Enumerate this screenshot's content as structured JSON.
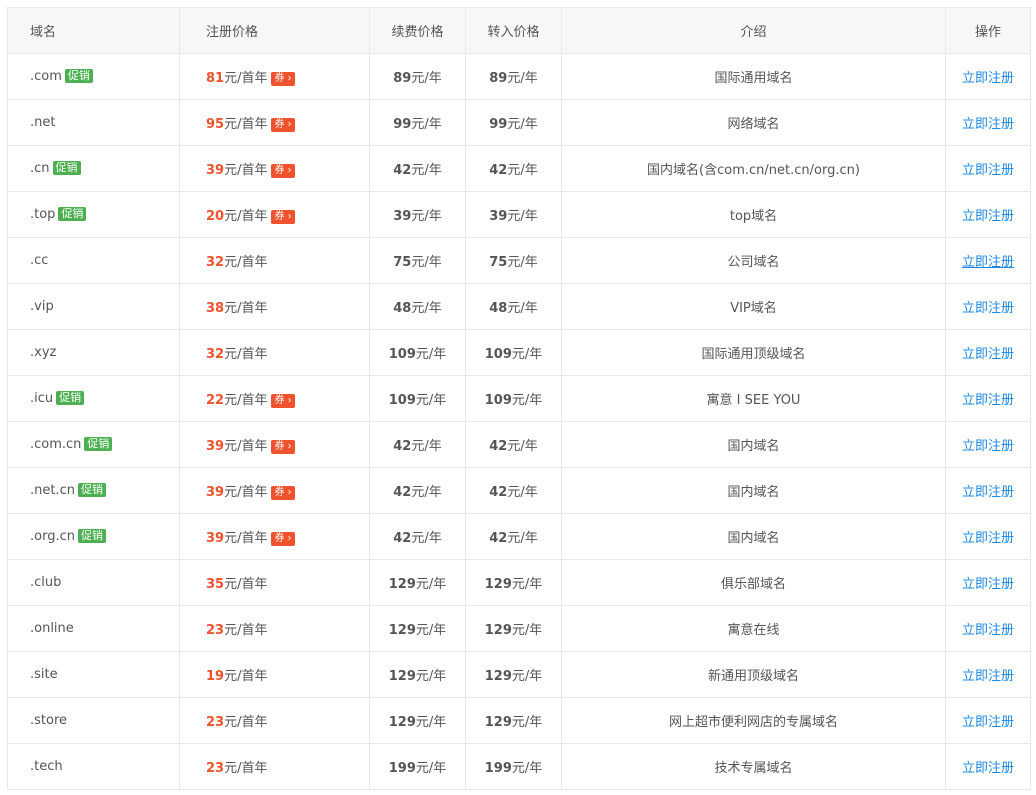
{
  "table": {
    "headers": {
      "domain": "域名",
      "register": "注册价格",
      "renew": "续费价格",
      "transfer": "转入价格",
      "intro": "介绍",
      "action": "操作"
    },
    "promo_badge": "促销",
    "coupon_badge": "券 ›",
    "register_suffix": "元/首年",
    "year_suffix": "元/年",
    "action_label": "立即注册",
    "rows": [
      {
        "domain": ".com",
        "promo": true,
        "reg": "81",
        "coupon": true,
        "renew": "89",
        "transfer": "89",
        "intro": "国际通用域名"
      },
      {
        "domain": ".net",
        "promo": false,
        "reg": "95",
        "coupon": true,
        "renew": "99",
        "transfer": "99",
        "intro": "网络域名"
      },
      {
        "domain": ".cn",
        "promo": true,
        "reg": "39",
        "coupon": true,
        "renew": "42",
        "transfer": "42",
        "intro": "国内域名(含com.cn/net.cn/org.cn)"
      },
      {
        "domain": ".top",
        "promo": true,
        "reg": "20",
        "coupon": true,
        "renew": "39",
        "transfer": "39",
        "intro": "top域名"
      },
      {
        "domain": ".cc",
        "promo": false,
        "reg": "32",
        "coupon": false,
        "renew": "75",
        "transfer": "75",
        "intro": "公司域名",
        "hover": true
      },
      {
        "domain": ".vip",
        "promo": false,
        "reg": "38",
        "coupon": false,
        "renew": "48",
        "transfer": "48",
        "intro": "VIP域名"
      },
      {
        "domain": ".xyz",
        "promo": false,
        "reg": "32",
        "coupon": false,
        "renew": "109",
        "transfer": "109",
        "intro": "国际通用顶级域名"
      },
      {
        "domain": ".icu",
        "promo": true,
        "reg": "22",
        "coupon": true,
        "renew": "109",
        "transfer": "109",
        "intro": "寓意 I SEE YOU"
      },
      {
        "domain": ".com.cn",
        "promo": true,
        "reg": "39",
        "coupon": true,
        "renew": "42",
        "transfer": "42",
        "intro": "国内域名"
      },
      {
        "domain": ".net.cn",
        "promo": true,
        "reg": "39",
        "coupon": true,
        "renew": "42",
        "transfer": "42",
        "intro": "国内域名"
      },
      {
        "domain": ".org.cn",
        "promo": true,
        "reg": "39",
        "coupon": true,
        "renew": "42",
        "transfer": "42",
        "intro": "国内域名"
      },
      {
        "domain": ".club",
        "promo": false,
        "reg": "35",
        "coupon": false,
        "renew": "129",
        "transfer": "129",
        "intro": "俱乐部域名"
      },
      {
        "domain": ".online",
        "promo": false,
        "reg": "23",
        "coupon": false,
        "renew": "129",
        "transfer": "129",
        "intro": "寓意在线"
      },
      {
        "domain": ".site",
        "promo": false,
        "reg": "19",
        "coupon": false,
        "renew": "129",
        "transfer": "129",
        "intro": "新通用顶级域名"
      },
      {
        "domain": ".store",
        "promo": false,
        "reg": "23",
        "coupon": false,
        "renew": "129",
        "transfer": "129",
        "intro": "网上超市便利网店的专属域名"
      },
      {
        "domain": ".tech",
        "promo": false,
        "reg": "23",
        "coupon": false,
        "renew": "199",
        "transfer": "199",
        "intro": "技术专属域名"
      }
    ]
  }
}
